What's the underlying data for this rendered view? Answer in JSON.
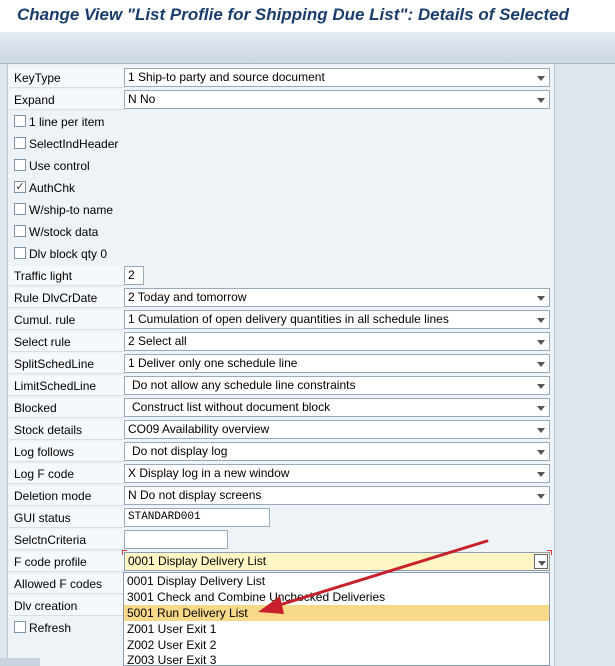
{
  "title": "Change View \"List Proflie for Shipping Due List\": Details of Selected",
  "fields": {
    "keytype": {
      "label": "KeyType",
      "value": "1 Ship-to party and source document"
    },
    "expand": {
      "label": "Expand",
      "value": "N No"
    },
    "traffic_light": {
      "label": "Traffic light",
      "value": "2"
    },
    "rule_dlvcrdate": {
      "label": "Rule DlvCrDate",
      "value": "2 Today and tomorrow"
    },
    "cumul_rule": {
      "label": "Cumul. rule",
      "value": "1 Cumulation of open delivery quantities in all schedule lines"
    },
    "select_rule": {
      "label": "Select rule",
      "value": "2 Select all"
    },
    "splitschedline": {
      "label": "SplitSchedLine",
      "value": "1 Deliver only one schedule line"
    },
    "limitschedline": {
      "label": "LimitSchedLine",
      "value": "Do not allow any schedule line constraints"
    },
    "blocked": {
      "label": "Blocked",
      "value": "Construct list without document block"
    },
    "stock_details": {
      "label": "Stock details",
      "value": "CO09 Availability overview"
    },
    "log_follows": {
      "label": "Log follows",
      "value": "Do not display log"
    },
    "log_f_code": {
      "label": "Log F code",
      "value": "X Display log in a new window"
    },
    "deletion_mode": {
      "label": "Deletion mode",
      "value": "N Do not display screens"
    },
    "gui_status": {
      "label": "GUI status",
      "value": "STANDARD001"
    },
    "selctncriteria": {
      "label": "SelctnCriteria",
      "value": ""
    },
    "f_code_profile": {
      "label": "F code profile",
      "value": "0001 Display Delivery List"
    },
    "allowed_f_codes": {
      "label": "Allowed F codes"
    },
    "dlv_creation": {
      "label": "Dlv creation"
    }
  },
  "checkboxes": [
    {
      "label": "1 line per item",
      "checked": false,
      "mark": ""
    },
    {
      "label": "SelectIndHeader",
      "checked": false,
      "mark": ""
    },
    {
      "label": "Use control",
      "checked": false,
      "mark": ""
    },
    {
      "label": "AuthChk",
      "checked": true,
      "mark": "✓"
    },
    {
      "label": "W/ship-to name",
      "checked": false,
      "mark": ""
    },
    {
      "label": "W/stock data",
      "checked": false,
      "mark": ""
    },
    {
      "label": "Dlv block qty 0",
      "checked": false,
      "mark": ""
    }
  ],
  "refresh": {
    "label": "Refresh",
    "checked": false,
    "mark": ""
  },
  "dropdown_options": [
    {
      "label": "0001 Display Delivery List",
      "highlighted": false
    },
    {
      "label": "3001 Check and Combine Unchecked Deliveries",
      "highlighted": false
    },
    {
      "label": "5001 Run Delivery List",
      "highlighted": true
    },
    {
      "label": "Z001 User Exit 1",
      "highlighted": false
    },
    {
      "label": "Z002 User Exit 2",
      "highlighted": false
    },
    {
      "label": "Z003 User Exit 3",
      "highlighted": false
    }
  ],
  "colors": {
    "accent_arrow": "#c8202a",
    "highlight": "#f8d98a",
    "active_field": "#fff6c4",
    "title": "#1a3d6b"
  }
}
